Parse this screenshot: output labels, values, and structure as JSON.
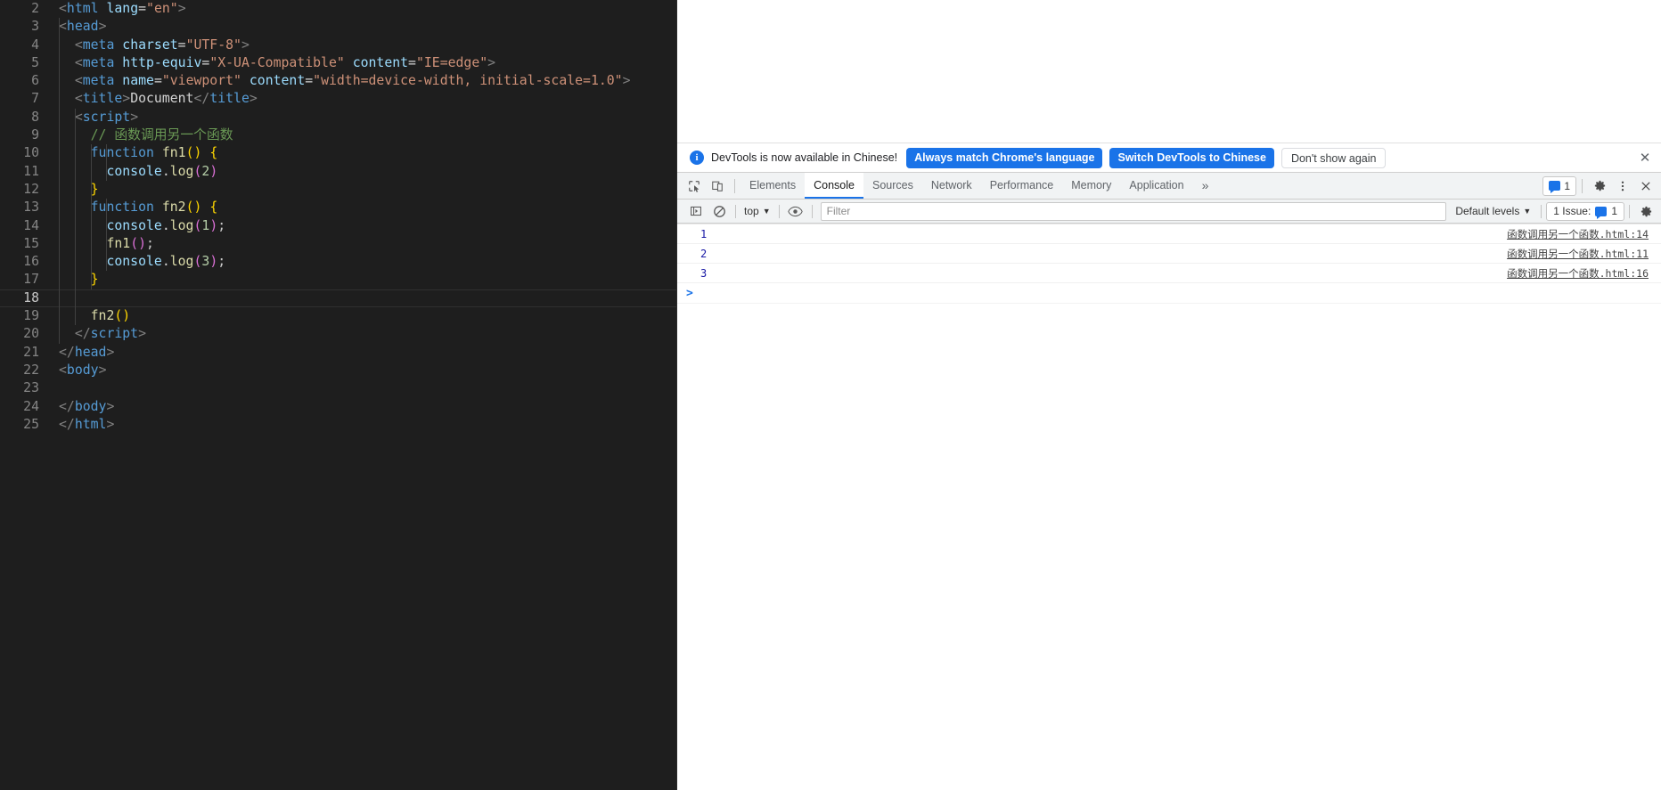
{
  "editor": {
    "name": "vscode-code-editor",
    "language": "html",
    "active_line": 18,
    "lines": [
      {
        "num": "2",
        "indent": 0,
        "tokens": [
          {
            "t": "punct",
            "v": "<"
          },
          {
            "t": "tag",
            "v": "html"
          },
          {
            "t": "plain",
            "v": " "
          },
          {
            "t": "attr",
            "v": "lang"
          },
          {
            "t": "op",
            "v": "="
          },
          {
            "t": "str",
            "v": "\"en\""
          },
          {
            "t": "punct",
            "v": ">"
          }
        ]
      },
      {
        "num": "3",
        "indent": 0,
        "tokens": [
          {
            "t": "punct",
            "v": "<"
          },
          {
            "t": "tag",
            "v": "head"
          },
          {
            "t": "punct",
            "v": ">"
          }
        ]
      },
      {
        "num": "4",
        "indent": 1,
        "tokens": [
          {
            "t": "punct",
            "v": "  <"
          },
          {
            "t": "tag",
            "v": "meta"
          },
          {
            "t": "plain",
            "v": " "
          },
          {
            "t": "attr",
            "v": "charset"
          },
          {
            "t": "op",
            "v": "="
          },
          {
            "t": "str",
            "v": "\"UTF-8\""
          },
          {
            "t": "punct",
            "v": ">"
          }
        ]
      },
      {
        "num": "5",
        "indent": 1,
        "tokens": [
          {
            "t": "punct",
            "v": "  <"
          },
          {
            "t": "tag",
            "v": "meta"
          },
          {
            "t": "plain",
            "v": " "
          },
          {
            "t": "attr",
            "v": "http-equiv"
          },
          {
            "t": "op",
            "v": "="
          },
          {
            "t": "str",
            "v": "\"X-UA-Compatible\""
          },
          {
            "t": "plain",
            "v": " "
          },
          {
            "t": "attr",
            "v": "content"
          },
          {
            "t": "op",
            "v": "="
          },
          {
            "t": "str",
            "v": "\"IE=edge\""
          },
          {
            "t": "punct",
            "v": ">"
          }
        ]
      },
      {
        "num": "6",
        "indent": 1,
        "tokens": [
          {
            "t": "punct",
            "v": "  <"
          },
          {
            "t": "tag",
            "v": "meta"
          },
          {
            "t": "plain",
            "v": " "
          },
          {
            "t": "attr",
            "v": "name"
          },
          {
            "t": "op",
            "v": "="
          },
          {
            "t": "str",
            "v": "\"viewport\""
          },
          {
            "t": "plain",
            "v": " "
          },
          {
            "t": "attr",
            "v": "content"
          },
          {
            "t": "op",
            "v": "="
          },
          {
            "t": "str",
            "v": "\"width=device-width, initial-scale=1.0\""
          },
          {
            "t": "punct",
            "v": ">"
          }
        ]
      },
      {
        "num": "7",
        "indent": 1,
        "tokens": [
          {
            "t": "punct",
            "v": "  <"
          },
          {
            "t": "tag",
            "v": "title"
          },
          {
            "t": "punct",
            "v": ">"
          },
          {
            "t": "text",
            "v": "Document"
          },
          {
            "t": "punct",
            "v": "</"
          },
          {
            "t": "tag",
            "v": "title"
          },
          {
            "t": "punct",
            "v": ">"
          }
        ]
      },
      {
        "num": "8",
        "indent": 1,
        "tokens": [
          {
            "t": "punct",
            "v": "  <"
          },
          {
            "t": "tag",
            "v": "script"
          },
          {
            "t": "punct",
            "v": ">"
          }
        ]
      },
      {
        "num": "9",
        "indent": 2,
        "tokens": [
          {
            "t": "comment",
            "v": "    // 函数调用另一个函数"
          }
        ]
      },
      {
        "num": "10",
        "indent": 2,
        "tokens": [
          {
            "t": "plain",
            "v": "    "
          },
          {
            "t": "kw",
            "v": "function"
          },
          {
            "t": "plain",
            "v": " "
          },
          {
            "t": "fn",
            "v": "fn1"
          },
          {
            "t": "brace-y",
            "v": "("
          },
          {
            "t": "brace-y",
            "v": ")"
          },
          {
            "t": "plain",
            "v": " "
          },
          {
            "t": "brace-y",
            "v": "{"
          }
        ]
      },
      {
        "num": "11",
        "indent": 3,
        "tokens": [
          {
            "t": "plain",
            "v": "      "
          },
          {
            "t": "obj",
            "v": "console"
          },
          {
            "t": "op",
            "v": "."
          },
          {
            "t": "prop",
            "v": "log"
          },
          {
            "t": "brace-p",
            "v": "("
          },
          {
            "t": "num",
            "v": "2"
          },
          {
            "t": "brace-p",
            "v": ")"
          }
        ]
      },
      {
        "num": "12",
        "indent": 2,
        "tokens": [
          {
            "t": "plain",
            "v": "    "
          },
          {
            "t": "brace-y",
            "v": "}"
          }
        ]
      },
      {
        "num": "13",
        "indent": 2,
        "tokens": [
          {
            "t": "plain",
            "v": "    "
          },
          {
            "t": "kw",
            "v": "function"
          },
          {
            "t": "plain",
            "v": " "
          },
          {
            "t": "fn",
            "v": "fn2"
          },
          {
            "t": "brace-y",
            "v": "("
          },
          {
            "t": "brace-y",
            "v": ")"
          },
          {
            "t": "plain",
            "v": " "
          },
          {
            "t": "brace-y",
            "v": "{"
          }
        ]
      },
      {
        "num": "14",
        "indent": 3,
        "tokens": [
          {
            "t": "plain",
            "v": "      "
          },
          {
            "t": "obj",
            "v": "console"
          },
          {
            "t": "op",
            "v": "."
          },
          {
            "t": "prop",
            "v": "log"
          },
          {
            "t": "brace-p",
            "v": "("
          },
          {
            "t": "num",
            "v": "1"
          },
          {
            "t": "brace-p",
            "v": ")"
          },
          {
            "t": "plain",
            "v": ";"
          }
        ]
      },
      {
        "num": "15",
        "indent": 3,
        "tokens": [
          {
            "t": "plain",
            "v": "      "
          },
          {
            "t": "fn",
            "v": "fn1"
          },
          {
            "t": "brace-p",
            "v": "("
          },
          {
            "t": "brace-p",
            "v": ")"
          },
          {
            "t": "plain",
            "v": ";"
          }
        ]
      },
      {
        "num": "16",
        "indent": 3,
        "tokens": [
          {
            "t": "plain",
            "v": "      "
          },
          {
            "t": "obj",
            "v": "console"
          },
          {
            "t": "op",
            "v": "."
          },
          {
            "t": "prop",
            "v": "log"
          },
          {
            "t": "brace-p",
            "v": "("
          },
          {
            "t": "num",
            "v": "3"
          },
          {
            "t": "brace-p",
            "v": ")"
          },
          {
            "t": "plain",
            "v": ";"
          }
        ]
      },
      {
        "num": "17",
        "indent": 2,
        "tokens": [
          {
            "t": "plain",
            "v": "    "
          },
          {
            "t": "brace-y",
            "v": "}"
          }
        ]
      },
      {
        "num": "18",
        "indent": 2,
        "tokens": [
          {
            "t": "plain",
            "v": ""
          }
        ]
      },
      {
        "num": "19",
        "indent": 2,
        "tokens": [
          {
            "t": "plain",
            "v": "    "
          },
          {
            "t": "fn",
            "v": "fn2"
          },
          {
            "t": "brace-y",
            "v": "("
          },
          {
            "t": "brace-y",
            "v": ")"
          }
        ]
      },
      {
        "num": "20",
        "indent": 1,
        "tokens": [
          {
            "t": "punct",
            "v": "  </"
          },
          {
            "t": "tag",
            "v": "script"
          },
          {
            "t": "punct",
            "v": ">"
          }
        ]
      },
      {
        "num": "21",
        "indent": 0,
        "tokens": [
          {
            "t": "punct",
            "v": "</"
          },
          {
            "t": "tag",
            "v": "head"
          },
          {
            "t": "punct",
            "v": ">"
          }
        ]
      },
      {
        "num": "22",
        "indent": 0,
        "tokens": [
          {
            "t": "punct",
            "v": "<"
          },
          {
            "t": "tag",
            "v": "body"
          },
          {
            "t": "punct",
            "v": ">"
          }
        ]
      },
      {
        "num": "23",
        "indent": 0,
        "tokens": [
          {
            "t": "plain",
            "v": ""
          }
        ]
      },
      {
        "num": "24",
        "indent": 0,
        "tokens": [
          {
            "t": "punct",
            "v": "</"
          },
          {
            "t": "tag",
            "v": "body"
          },
          {
            "t": "punct",
            "v": ">"
          }
        ]
      },
      {
        "num": "25",
        "indent": 0,
        "tokens": [
          {
            "t": "punct",
            "v": "</"
          },
          {
            "t": "tag",
            "v": "html"
          },
          {
            "t": "punct",
            "v": ">"
          }
        ]
      }
    ]
  },
  "devtools": {
    "notice": {
      "message": "DevTools is now available in Chinese!",
      "primary_button": "Always match Chrome's language",
      "secondary_button": "Switch DevTools to Chinese",
      "dismiss_button": "Don't show again",
      "close_icon": "close-icon",
      "info_icon": "info-icon",
      "accent_color": "#1a73e8"
    },
    "tabs": [
      {
        "label": "Elements",
        "selected": false
      },
      {
        "label": "Console",
        "selected": true
      },
      {
        "label": "Sources",
        "selected": false
      },
      {
        "label": "Network",
        "selected": false
      },
      {
        "label": "Performance",
        "selected": false
      },
      {
        "label": "Memory",
        "selected": false
      },
      {
        "label": "Application",
        "selected": false
      }
    ],
    "tabbar": {
      "inspect_icon": "inspect-element-icon",
      "device_icon": "device-toolbar-icon",
      "more_tabs": "»",
      "message_count": "1",
      "settings_icon": "gear-icon",
      "menu_icon": "kebab-menu-icon",
      "close_icon": "close-icon"
    },
    "console_toolbar": {
      "sidebar_icon": "console-sidebar-icon",
      "clear_icon": "clear-console-icon",
      "context_value": "top",
      "eye_icon": "live-expression-eye-icon",
      "filter_placeholder": "Filter",
      "filter_value": "",
      "levels_value": "Default levels",
      "issues_label": "1 Issue:",
      "issues_count": "1",
      "settings_icon": "console-settings-gear-icon"
    },
    "console_messages": [
      {
        "value": "1",
        "source": "函数调用另一个函数.html:14"
      },
      {
        "value": "2",
        "source": "函数调用另一个函数.html:11"
      },
      {
        "value": "3",
        "source": "函数调用另一个函数.html:16"
      }
    ],
    "prompt": {
      "caret": ">",
      "value": ""
    }
  }
}
